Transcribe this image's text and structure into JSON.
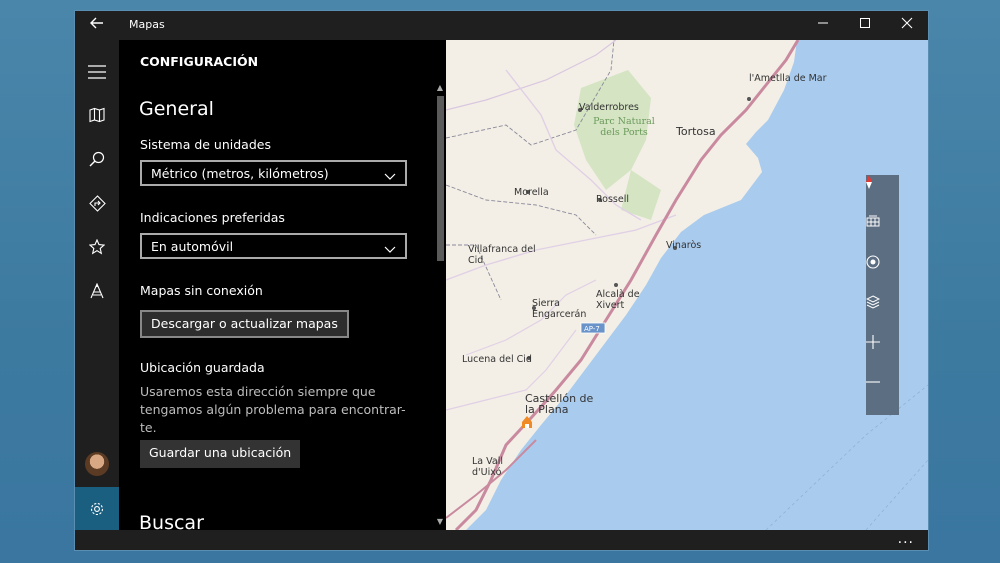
{
  "window": {
    "title": "Mapas",
    "back_icon": "back-arrow-icon",
    "minimize_icon": "minimize-icon",
    "maximize_icon": "maximize-icon",
    "close_icon": "close-icon"
  },
  "rail": {
    "items": [
      "hamburger-menu-icon",
      "map-icon",
      "search-icon",
      "directions-icon",
      "favorites-star-icon",
      "landmarks-icon"
    ],
    "avatar_icon": "user-avatar",
    "settings_icon": "gear-icon",
    "active_color": "#1b5f80"
  },
  "settings": {
    "header": "CONFIGURACIÓN",
    "general_heading": "General",
    "units_label": "Sistema de unidades",
    "units_value": "Métrico (metros, kilómetros)",
    "directions_label": "Indicaciones preferidas",
    "directions_value": "En automóvil",
    "offline_label": "Mapas sin conexión",
    "offline_button": "Descargar o actualizar mapas",
    "saved_location_label": "Ubicación guardada",
    "saved_location_desc": "Usaremos esta dirección siempre que tengamos algún problema para encontrar-te.",
    "save_location_button": "Guardar una ubicación",
    "search_heading": "Buscar"
  },
  "map": {
    "labels": {
      "ametlla": "l'Ametlla de Mar",
      "valderrobres": "Valderrobres",
      "parc": "Parc Natural dels Ports",
      "tortosa": "Tortosa",
      "morella": "Morella",
      "rossell": "Rossell",
      "vinaros": "Vinaròs",
      "villafranca": "Villafranca del Cid",
      "alcala": "Alcalà de Xivert",
      "sierra": "Sierra Engarcerán",
      "ap7": "AP-7",
      "lucena": "Lucena del Cid",
      "castellon": "Castellón de la Plana",
      "lavall": "La Vall d'Uixó"
    },
    "controls": [
      "compass-icon",
      "3d-cities-icon",
      "my-location-icon",
      "map-layers-icon",
      "zoom-in-icon",
      "zoom-out-icon"
    ],
    "sea_color": "#a9cbee",
    "land_color": "#f3efe6"
  },
  "statusbar": {
    "more": "..."
  }
}
